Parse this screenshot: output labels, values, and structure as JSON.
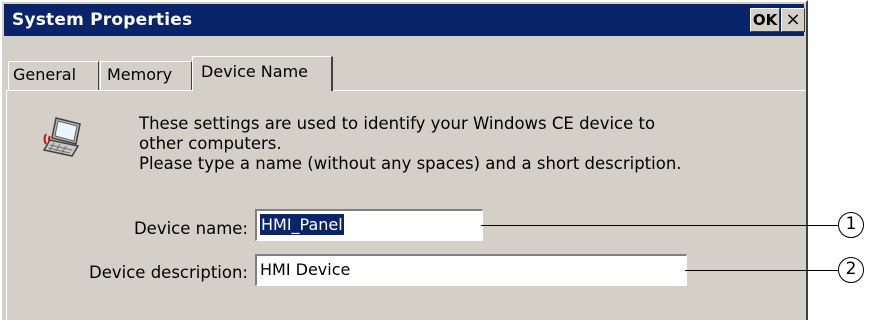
{
  "window": {
    "title": "System Properties",
    "ok_label": "OK",
    "close_label": "×"
  },
  "tabs": [
    {
      "label": "General",
      "active": false
    },
    {
      "label": "Memory",
      "active": false
    },
    {
      "label": "Device Name",
      "active": true
    }
  ],
  "content": {
    "icon": "laptop-network-icon",
    "description_lines": [
      "These settings are used to identify your Windows CE device to",
      "other computers.",
      "Please type a name (without any spaces) and a short description."
    ],
    "device_name_label": "Device name:",
    "device_name_value": "HMI_Panel",
    "device_description_label": "Device description:",
    "device_description_value": "HMI Device"
  },
  "callouts": [
    "1",
    "2"
  ],
  "colors": {
    "title_bar": "#0a246a",
    "face": "#d4d0c8",
    "selection": "#0a246a"
  }
}
